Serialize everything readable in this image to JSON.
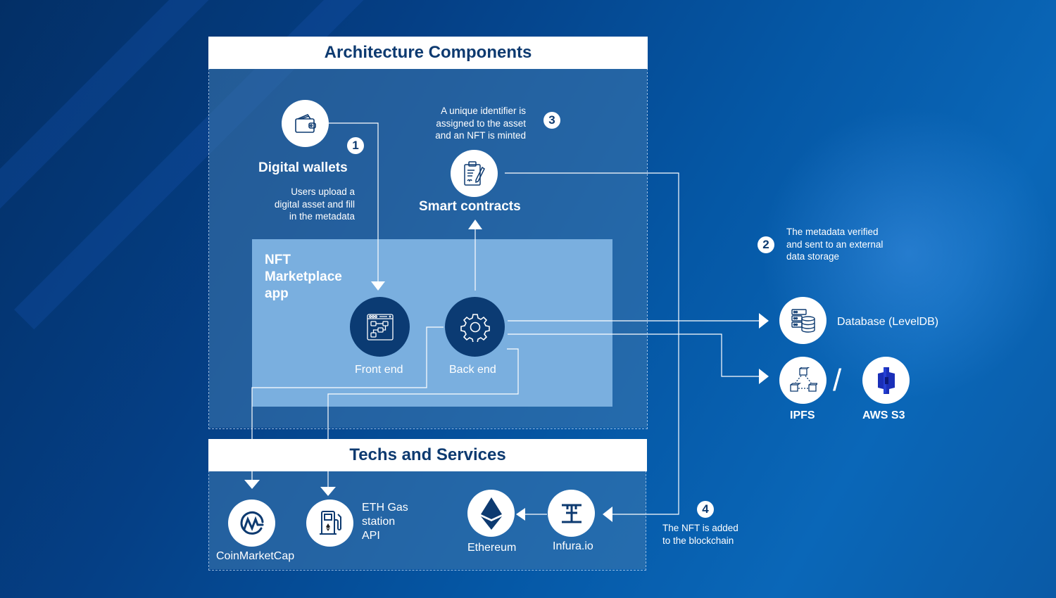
{
  "sections": {
    "architecture_title": "Architecture Components",
    "techs_title": "Techs and Services"
  },
  "app": {
    "title_line1": "NFT",
    "title_line2": "Marketplace",
    "title_line3": "app",
    "front_end": "Front end",
    "back_end": "Back end"
  },
  "components": {
    "digital_wallets": "Digital wallets",
    "smart_contracts": "Smart contracts",
    "database": "Database (LevelDB)",
    "ipfs": "IPFS",
    "aws_s3": "AWS S3",
    "separator": "/"
  },
  "steps": [
    {
      "number": "1",
      "text_lines": [
        "Users upload a",
        "digital asset and fill",
        "in the metadata"
      ]
    },
    {
      "number": "2",
      "text_lines": [
        "The metadata verified",
        "and sent to an external",
        "data storage"
      ]
    },
    {
      "number": "3",
      "text_lines": [
        "A unique identifier is",
        "assigned to the asset",
        "and an NFT is minted"
      ]
    },
    {
      "number": "4",
      "text_lines": [
        "The NFT is added",
        "to the blockchain"
      ]
    }
  ],
  "services": {
    "coinmarketcap": "CoinMarketCap",
    "eth_gas_line1": "ETH Gas",
    "eth_gas_line2": "station",
    "eth_gas_line3": "API",
    "ethereum": "Ethereum",
    "infura": "Infura.io"
  },
  "colors": {
    "header_text": "#0d3a70",
    "app_box": "#7aafdf",
    "dark_circle": "#0b3b73",
    "aws_icon": "#1a2fb8"
  }
}
